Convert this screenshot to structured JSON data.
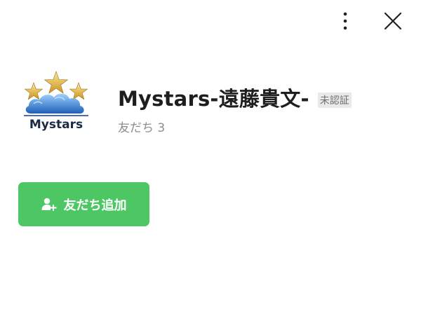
{
  "header": {
    "more_icon": "more-vertical-icon",
    "close_icon": "close-icon"
  },
  "profile": {
    "name": "Mystars-遠藤貴文-",
    "badge": "未認証",
    "friends_label": "友だち 3",
    "logo_text": "Mystars"
  },
  "actions": {
    "add_friend_label": "友だち追加",
    "add_friend_icon": "add-user-icon"
  },
  "colors": {
    "accent": "#4cc764",
    "background": "#ffffff",
    "text": "#1e1e1e",
    "muted": "#8c8c8c",
    "badge_bg": "#e9e9e9"
  }
}
